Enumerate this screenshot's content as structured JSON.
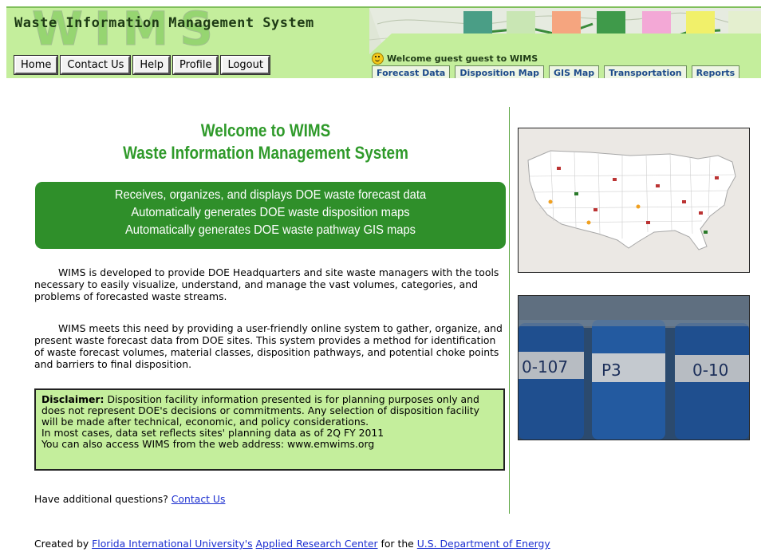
{
  "header": {
    "title": "Waste Information Management System",
    "logo_letters": "WIMS",
    "nav": [
      "Home",
      "Contact Us",
      "Help",
      "Profile",
      "Logout"
    ],
    "welcome": "Welcome guest guest to WIMS",
    "tabs": [
      "Forecast Data",
      "Disposition Map",
      "GIS Map",
      "Transportation",
      "Reports"
    ]
  },
  "main": {
    "heading_line1": "Welcome to WIMS",
    "heading_line2": "Waste Information Management System",
    "features": [
      "Receives, organizes, and displays DOE waste forecast data",
      "Automatically generates DOE waste disposition maps",
      "Automatically generates DOE waste pathway GIS maps"
    ],
    "paragraph1": "WIMS is developed to provide DOE Headquarters and site waste managers with the tools necessary to easily visualize, understand, and manage the vast volumes, categories, and problems of forecasted waste streams.",
    "paragraph2": "WIMS meets this need by providing a user-friendly online system to gather, organize, and present waste forecast data from DOE sites.  This system provides a method for identification of waste forecast volumes, material classes, disposition pathways, and potential choke points and barriers to final disposition.",
    "disclaimer": {
      "label": "Disclaimer:",
      "text": " Disposition facility information presented is for planning purposes only and does not represent DOE's decisions or commitments. Any selection of disposition facility will be made after technical, economic, and policy considerations.",
      "line2": "In most cases, data set reflects sites' planning data as of 2Q FY 2011",
      "line3": "You can also access WIMS from the web address: www.emwims.org"
    },
    "questions_text": "Have additional questions? ",
    "questions_link": "Contact Us"
  },
  "images": {
    "barrel_labels": [
      "0-107",
      "P3",
      "0-10"
    ]
  },
  "footer": {
    "created_by": "Created by ",
    "link1": "Florida International University's",
    "sep1": " ",
    "link2": "Applied Research Center",
    "for_text": " for the ",
    "link3": "U.S. Department of Energy"
  }
}
